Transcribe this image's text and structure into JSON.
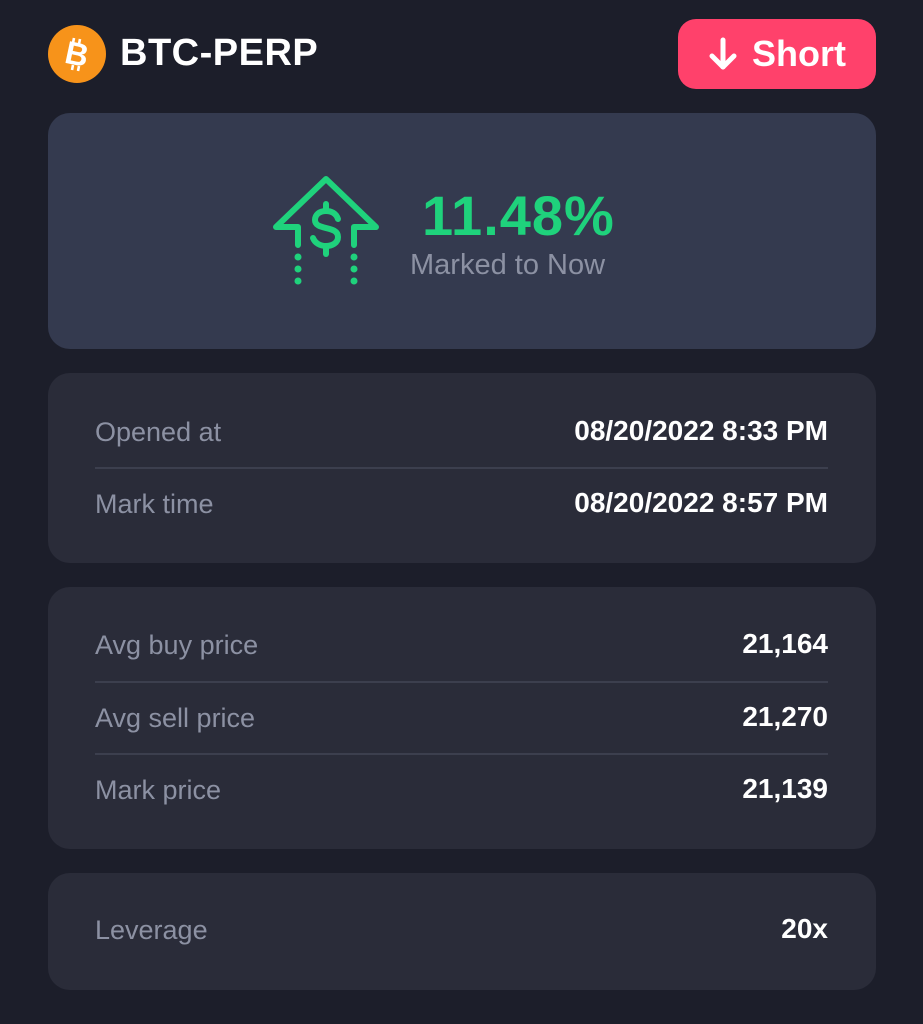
{
  "header": {
    "pair": "BTC-PERP",
    "coin_icon": "bitcoin-icon",
    "action_label": "Short",
    "action_icon": "arrow-down-icon",
    "action_color": "#ff416b"
  },
  "pnl": {
    "value": "11.48%",
    "label": "Marked to Now",
    "icon": "dollar-up-arrow-icon",
    "color": "#1fd27c"
  },
  "times": {
    "rows": [
      {
        "label": "Opened at",
        "value": "08/20/2022 8:33 PM"
      },
      {
        "label": "Mark time",
        "value": "08/20/2022 8:57 PM"
      }
    ]
  },
  "prices": {
    "rows": [
      {
        "label": "Avg buy price",
        "value": "21,164"
      },
      {
        "label": "Avg sell price",
        "value": "21,270"
      },
      {
        "label": "Mark price",
        "value": "21,139"
      }
    ]
  },
  "leverage": {
    "rows": [
      {
        "label": "Leverage",
        "value": "20x"
      }
    ]
  }
}
